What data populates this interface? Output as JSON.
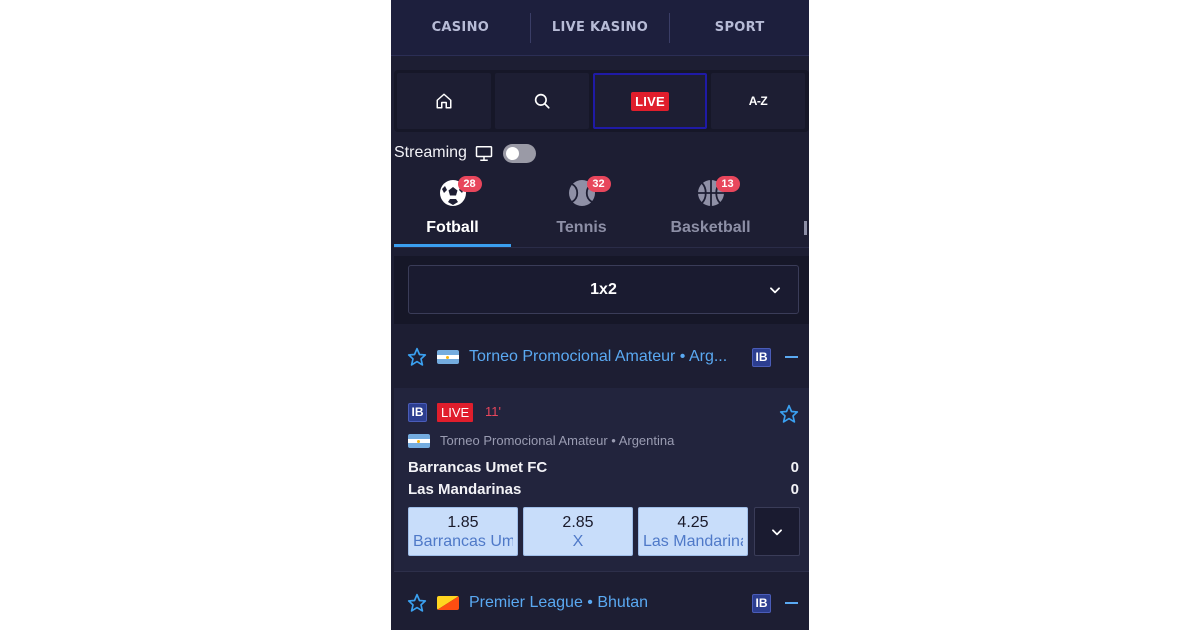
{
  "topnav": {
    "items": [
      "CASINO",
      "LIVE KASINO",
      "SPORT"
    ]
  },
  "quicktabs": {
    "live_label": "LIVE",
    "az_label": "A-Z"
  },
  "streaming": {
    "label": "Streaming",
    "toggle_on": false
  },
  "sports": [
    {
      "name": "Fotball",
      "count": "28",
      "active": true
    },
    {
      "name": "Tennis",
      "count": "32",
      "active": false
    },
    {
      "name": "Basketball",
      "count": "13",
      "active": false
    }
  ],
  "market": {
    "value": "1x2"
  },
  "leagues": [
    {
      "title": "Torneo Promocional Amateur • Arg...",
      "badge": "IB"
    },
    {
      "title": "Premier League • Bhutan",
      "badge": "IB"
    }
  ],
  "event": {
    "badge": "IB",
    "live_label": "LIVE",
    "minute": "11'",
    "competition": "Torneo Promocional Amateur • Argentina",
    "home_team": "Barrancas Umet FC",
    "away_team": "Las Mandarinas",
    "home_score": "0",
    "away_score": "0",
    "odds": [
      {
        "value": "1.85",
        "label": "Barrancas Umet FC"
      },
      {
        "value": "2.85",
        "label": "X"
      },
      {
        "value": "4.25",
        "label": "Las Mandarinas"
      }
    ]
  },
  "colors": {
    "accent": "#3a9ff0",
    "live": "#e01e2c",
    "badge": "#e8465c",
    "link": "#5aa9f2"
  }
}
